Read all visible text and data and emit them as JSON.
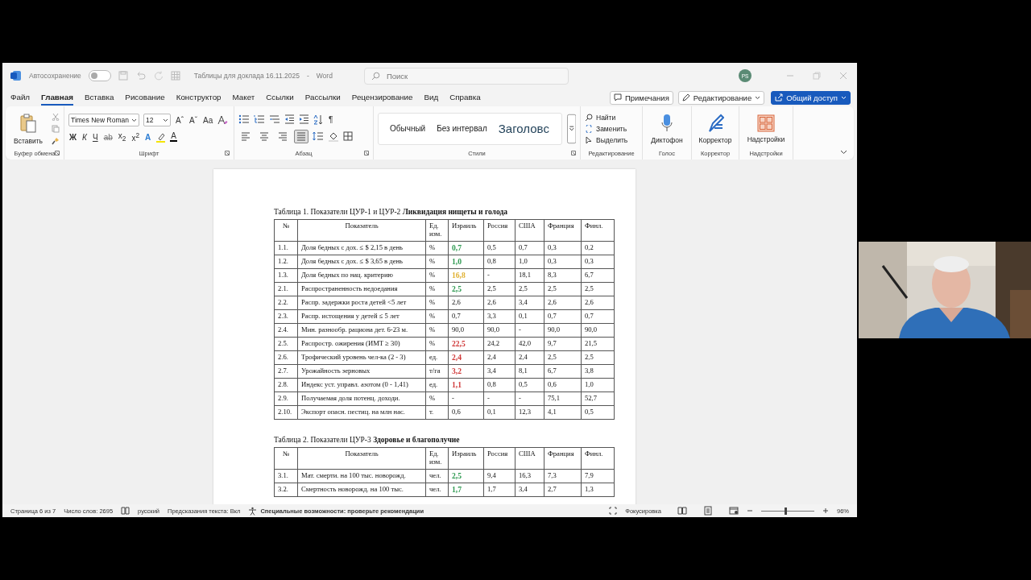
{
  "titlebar": {
    "autosave": "Автосохранение",
    "autosave_on": false,
    "document": "Таблицы для доклада 16.11.2025",
    "separator": "-",
    "app": "Word",
    "search_placeholder": "Поиск",
    "avatar": "PS"
  },
  "menu_tabs": [
    {
      "label": "Файл",
      "selected": false
    },
    {
      "label": "Главная",
      "selected": true
    },
    {
      "label": "Вставка",
      "selected": false
    },
    {
      "label": "Рисование",
      "selected": false
    },
    {
      "label": "Конструктор",
      "selected": false
    },
    {
      "label": "Макет",
      "selected": false
    },
    {
      "label": "Ссылки",
      "selected": false
    },
    {
      "label": "Рассылки",
      "selected": false
    },
    {
      "label": "Рецензирование",
      "selected": false
    },
    {
      "label": "Вид",
      "selected": false
    },
    {
      "label": "Справка",
      "selected": false
    }
  ],
  "menu_buttons": {
    "comments": "Примечания",
    "editing": "Редактирование",
    "share": "Общий доступ"
  },
  "ribbon": {
    "clipboard": {
      "paste": "Вставить",
      "label": "Буфер обмена"
    },
    "font": {
      "name": "Times New Roman",
      "size": "12",
      "grow": "Aˆ",
      "shrink": "Aˇ",
      "case": "Aa",
      "styles": [
        "Ж",
        "К",
        "Ч"
      ],
      "strike": "ab",
      "sub": "x$_{2}$",
      "sup": "x$^{2}$",
      "effects": "A",
      "font_color_letter": "A",
      "label": "Шрифт"
    },
    "paragraph": {
      "label": "Абзац",
      "pilcrow": "¶",
      "align_buttons": [
        {
          "selected": false
        },
        {
          "selected": false
        },
        {
          "selected": false
        },
        {
          "selected": true
        }
      ]
    },
    "styles": {
      "items": [
        "Обычный",
        "Без интервал",
        "Заголовс"
      ],
      "label": "Стили"
    },
    "editing": {
      "items": [
        "Найти",
        "Заменить",
        "Выделить"
      ],
      "label": "Редактирование"
    },
    "voice": {
      "button": "Диктофон",
      "label": "Голос"
    },
    "editor": {
      "button": "Корректор",
      "label": "Корректор"
    },
    "addins": {
      "button": "Надстройки",
      "label": "Надстройки"
    }
  },
  "tables": [
    {
      "caption": "Таблица 1. Показатели ЦУР-1 и ЦУР-2 **Ликвидация нищеты и голода**",
      "columns": [
        "№",
        "Показатель",
        "Ед. изм.",
        "Израиль",
        "Россия",
        "США",
        "Франция",
        "Финл."
      ],
      "rows": [
        {
          "no": "1.1.",
          "name": "Доля бедных с дох. ≤ $ 2,15 в день",
          "unit": "%",
          "israel": {
            "text": "0,7",
            "color": "#2f9a52"
          },
          "values": [
            "0,5",
            "0,7",
            "0,3",
            "0,2"
          ]
        },
        {
          "no": "1.2.",
          "name": "Доля бедных с дох. ≤ $ 3,65 в день",
          "unit": "%",
          "israel": {
            "text": "1,0",
            "color": "#2f9a52"
          },
          "values": [
            "0,8",
            "1,0",
            "0,3",
            "0,3"
          ]
        },
        {
          "no": "1.3.",
          "name": "Доля бедных по нац. критерию",
          "unit": "%",
          "israel": {
            "text": "16,8",
            "color": "#e0b030"
          },
          "values": [
            "-",
            "18,1",
            "8,3",
            "6,7"
          ]
        },
        {
          "no": "2.1.",
          "name": "Распространенность недоедания",
          "unit": "%",
          "israel": {
            "text": "2,5",
            "color": "#2f9a52"
          },
          "values": [
            "2,5",
            "2,5",
            "2,5",
            "2,5"
          ]
        },
        {
          "no": "2.2.",
          "name": "Распр. задержки роста детей <5 лет",
          "unit": "%",
          "israel": {
            "text": "2,6"
          },
          "values": [
            "2,6",
            "3,4",
            "2,6",
            "2,6"
          ]
        },
        {
          "no": "2.3.",
          "name": "Распр. истощения у детей ≤ 5 лет",
          "unit": "%",
          "israel": {
            "text": "0,7"
          },
          "values": [
            "3,3",
            "0,1",
            "0,7",
            "0,7"
          ]
        },
        {
          "no": "2.4.",
          "name": "Мин. разнообр. рациона дет. 6-23 м.",
          "unit": "%",
          "israel": {
            "text": "90,0"
          },
          "values": [
            "90,0",
            "-",
            "90,0",
            "90,0"
          ]
        },
        {
          "no": "2.5.",
          "name": "Распростр. ожирения (ИМТ ≥ 30)",
          "unit": "%",
          "israel": {
            "text": "22,5",
            "color": "#d03a3a"
          },
          "values": [
            "24,2",
            "42,0",
            "9,7",
            "21,5"
          ]
        },
        {
          "no": "2.6.",
          "name": "Трофический уровень чел-ка (2 - 3)",
          "unit": "ед.",
          "israel": {
            "text": "2,4",
            "color": "#d03a3a"
          },
          "values": [
            "2,4",
            "2,4",
            "2,5",
            "2,5"
          ]
        },
        {
          "no": "2.7.",
          "name": "Урожайность зерновых",
          "unit": "т/га",
          "israel": {
            "text": "3,2",
            "color": "#d03a3a"
          },
          "values": [
            "3,4",
            "8,1",
            "6,7",
            "3,8"
          ]
        },
        {
          "no": "2.8.",
          "name": "Индекс уст. управл. азотом (0 - 1,41)",
          "unit": "ед.",
          "israel": {
            "text": "1,1",
            "color": "#d03a3a"
          },
          "values": [
            "0,8",
            "0,5",
            "0,6",
            "1,0"
          ]
        },
        {
          "no": "2.9.",
          "name": "Получаемая доля потенц. доходи.",
          "unit": "%",
          "israel": {
            "text": "-"
          },
          "values": [
            "-",
            "-",
            "75,1",
            "52,7"
          ]
        },
        {
          "no": "2.10.",
          "name": "Экспорт опасн. пестиц. на млн нас.",
          "unit": "т.",
          "israel": {
            "text": "0,6"
          },
          "values": [
            "0,1",
            "12,3",
            "4,1",
            "0,5"
          ]
        }
      ]
    },
    {
      "caption": "Таблица 2. Показатели ЦУР-3 **Здоровье и благополучие**",
      "columns": [
        "№",
        "Показатель",
        "Ед. изм.",
        "Израиль",
        "Россия",
        "США",
        "Франция",
        "Финл."
      ],
      "rows": [
        {
          "no": "3.1.",
          "name": "Мат. смерти. на 100 тыс. новорожд.",
          "unit": "чел.",
          "israel": {
            "text": "2,5",
            "color": "#2f9a52"
          },
          "values": [
            "9,4",
            "16,3",
            "7,3",
            "7,9"
          ]
        },
        {
          "no": "3.2.",
          "name": "Смертность новорожд. на 100 тыс.",
          "unit": "чел.",
          "israel": {
            "text": "1,7",
            "color": "#2f9a52"
          },
          "values": [
            "1,7",
            "3,4",
            "2,7",
            "1,3"
          ]
        }
      ]
    }
  ],
  "status_bar": {
    "page": "Страница 6 из 7",
    "words": "Число слов: 2695",
    "language": "русский",
    "prediction": "Предсказания текста: Вкл",
    "accessibility": "Специальные возможности: проверьте рекомендации",
    "focus": "Фокусировка",
    "zoom_slider": {
      "level": 0.46
    },
    "zoom": "96%"
  }
}
